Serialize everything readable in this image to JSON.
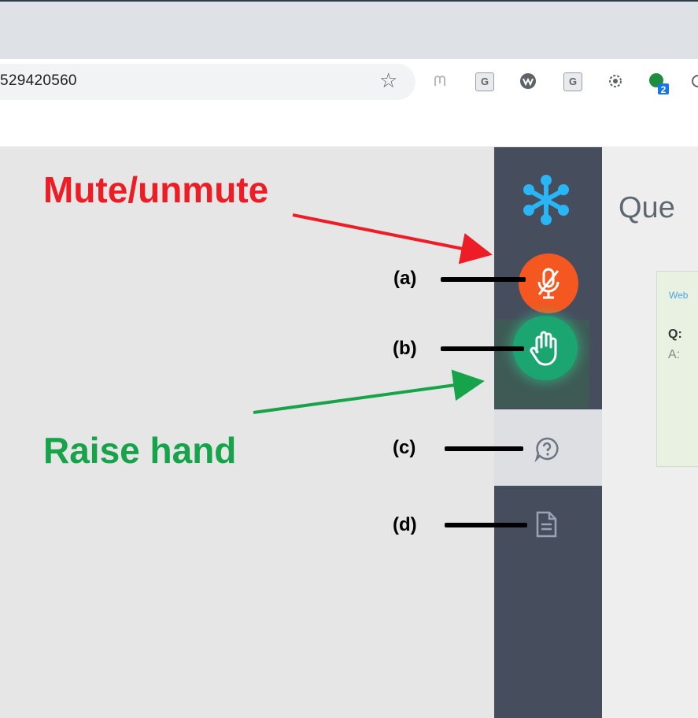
{
  "browser": {
    "url_text": "529420560",
    "bookmark_star_icon": "star-icon",
    "extensions": [
      {
        "name": "extension-icon-1",
        "glyph": "⦅⦆",
        "color": "#b0b0b0"
      },
      {
        "name": "extension-icon-g1",
        "glyph": "G",
        "color": "#5f6368"
      },
      {
        "name": "extension-icon-w",
        "glyph": "W",
        "color": "#5f6368"
      },
      {
        "name": "extension-icon-g2",
        "glyph": "G",
        "color": "#5f6368"
      },
      {
        "name": "extension-icon-gear",
        "glyph": "⚙",
        "color": "#5f6368"
      },
      {
        "name": "extension-icon-green",
        "glyph": "",
        "color": "#1e8e3e",
        "badge": "2"
      }
    ]
  },
  "sidebar": {
    "logo_icon": "snowflake-logo-icon",
    "mute_button_icon": "mic-off-icon",
    "raise_hand_icon": "hand-icon",
    "questions_icon": "question-icon",
    "notes_icon": "document-icon"
  },
  "content": {
    "title": "Que",
    "card": {
      "tag": "Web",
      "q_label": "Q:",
      "a_label": "A:"
    }
  },
  "annotations": {
    "mute_label": "Mute/unmute",
    "hand_label": "Raise hand",
    "a": "(a)",
    "b": "(b)",
    "c": "(c)",
    "d": "(d)"
  },
  "colors": {
    "mute_button": "#f4571f",
    "hand_button": "#1aa571",
    "rail": "#464e5e",
    "mute_annotation": "#ee1c24",
    "hand_annotation": "#16a34a"
  }
}
